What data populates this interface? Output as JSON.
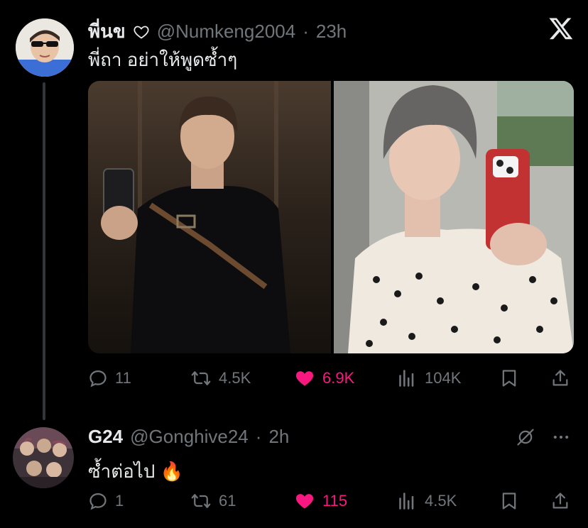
{
  "tweet": {
    "display_name": "พี่นข",
    "handle": "@Numkeng2004",
    "separator": "·",
    "time": "23h",
    "text": "พี่ถา อย่าให้พูดซ้ำๆ",
    "actions": {
      "replies": "11",
      "reposts": "4.5K",
      "likes": "6.9K",
      "views": "104K"
    }
  },
  "reply": {
    "display_name": "G24",
    "handle": "@Gonghive24",
    "separator": "·",
    "time": "2h",
    "text": "ซ้ำต่อไป 🔥",
    "actions": {
      "replies": "1",
      "reposts": "61",
      "likes": "115",
      "views": "4.5K"
    }
  },
  "icons": {
    "close": "x-logo-icon",
    "verified_heart": "heart-outline-icon",
    "reply": "reply-icon",
    "repost": "repost-icon",
    "like": "heart-filled-icon",
    "views": "views-icon",
    "bookmark": "bookmark-icon",
    "share": "share-icon",
    "hide": "hide-icon",
    "more": "more-icon"
  },
  "colors": {
    "background": "#000000",
    "text": "#e7e9ea",
    "muted": "#71767b",
    "like": "#f91880",
    "thread_line": "#333639"
  }
}
